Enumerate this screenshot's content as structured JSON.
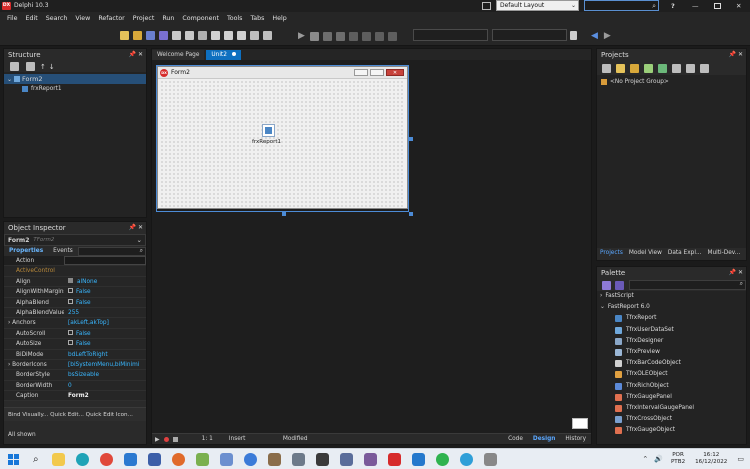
{
  "window": {
    "title": "Delphi 10.3",
    "app_badge": "DX"
  },
  "layout_selector": {
    "value": "Default Layout"
  },
  "search": {
    "placeholder": ""
  },
  "menu": [
    "File",
    "Edit",
    "Search",
    "View",
    "Refactor",
    "Project",
    "Run",
    "Component",
    "Tools",
    "Tabs",
    "Help"
  ],
  "structure": {
    "title": "Structure",
    "tree": [
      {
        "label": "Form2"
      },
      {
        "label": "frxReport1"
      }
    ]
  },
  "editor": {
    "tabs": [
      {
        "label": "Welcome Page"
      },
      {
        "label": "Unit2"
      }
    ],
    "form_title": "Form2",
    "form_badge": "DX",
    "component_label": "frxReport1"
  },
  "status": {
    "position": "1: 1",
    "mode": "Insert",
    "state": "Modified",
    "view_tabs": [
      "Code",
      "Design",
      "History"
    ]
  },
  "inspector": {
    "title": "Object Inspector",
    "selected": "Form2",
    "selected_type": "TForm2",
    "tabs": [
      "Properties",
      "Events"
    ],
    "rows": [
      {
        "name": "Action",
        "value": ""
      },
      {
        "name": "ActiveControl",
        "value": ""
      },
      {
        "name": "Align",
        "value": "alNone"
      },
      {
        "name": "AlignWithMargins",
        "value": "False"
      },
      {
        "name": "AlphaBlend",
        "value": "False"
      },
      {
        "name": "AlphaBlendValue",
        "value": "255"
      },
      {
        "name": "Anchors",
        "value": "[akLeft,akTop]"
      },
      {
        "name": "AutoScroll",
        "value": "False"
      },
      {
        "name": "AutoSize",
        "value": "False"
      },
      {
        "name": "BiDiMode",
        "value": "bdLeftToRight"
      },
      {
        "name": "BorderIcons",
        "value": "[biSystemMenu,biMinimi"
      },
      {
        "name": "BorderStyle",
        "value": "bsSizeable"
      },
      {
        "name": "BorderWidth",
        "value": "0"
      },
      {
        "name": "Caption",
        "value": "Form2"
      }
    ],
    "links": "Bind Visually... Quick Edit... Quick Edit Icon...",
    "footer": "All shown"
  },
  "projects": {
    "title": "Projects",
    "group": "<No Project Group>",
    "tabs": [
      "Projects",
      "Model View",
      "Data Expl...",
      "Multi-Dev..."
    ]
  },
  "palette": {
    "title": "Palette",
    "categories": [
      {
        "label": "FastScript",
        "expanded": false
      },
      {
        "label": "FastReport 6.0",
        "expanded": true
      }
    ],
    "items": [
      "TfrxReport",
      "TfrxUserDataSet",
      "TfrxDesigner",
      "TfrxPreview",
      "TfrxBarCodeObject",
      "TfrxOLEObject",
      "TfrxRichObject",
      "TfrxGaugePanel",
      "TfrxIntervalGaugePanel",
      "TfrxCrossObject",
      "TfrxGaugeObject"
    ]
  },
  "taskbar": {
    "lang": "POR",
    "layout": "PTB2",
    "time": "16:12",
    "date": "16/12/2022"
  },
  "colors": {
    "accent": "#0e70c0",
    "selection": "#264f78",
    "value_blue": "#39b7ff"
  }
}
